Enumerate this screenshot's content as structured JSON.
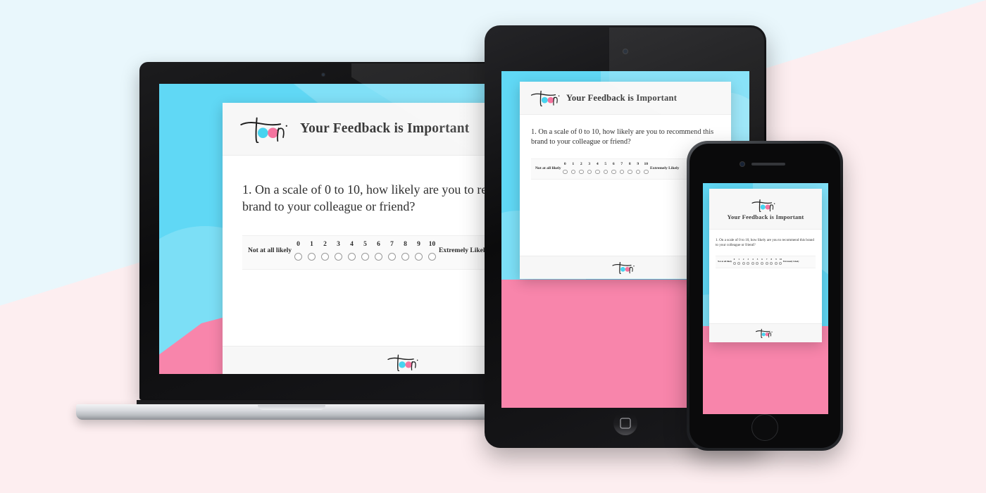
{
  "background": {
    "top_color": "#e9f7fc",
    "bottom_color": "#fdeef0"
  },
  "brand": {
    "name": "Toopi",
    "logo_name": "toopi-logo",
    "cyan": "#47d3ef",
    "pink": "#f4749f",
    "ink": "#1f1f1f"
  },
  "survey": {
    "header_title": "Your Feedback is Important",
    "question": " 1. On a scale of 0 to 10, how likely are you to recommend this brand to your colleague or friend?",
    "scale": {
      "labels": [
        "0",
        "1",
        "2",
        "3",
        "4",
        "5",
        "6",
        "7",
        "8",
        "9",
        "10"
      ],
      "left_label": "Not at all likely",
      "right_label": "Extremely Likely",
      "selected": null
    }
  },
  "devices": [
    {
      "name": "laptop",
      "type": "laptop",
      "screen_bg": "#60d8f5",
      "accent": "#f885ab"
    },
    {
      "name": "tablet",
      "type": "tablet",
      "screen_bg": "#60d8f5",
      "accent": "#f885ab"
    },
    {
      "name": "phone",
      "type": "phone",
      "screen_bg": "#60d8f5",
      "accent": "#f885ab"
    }
  ]
}
